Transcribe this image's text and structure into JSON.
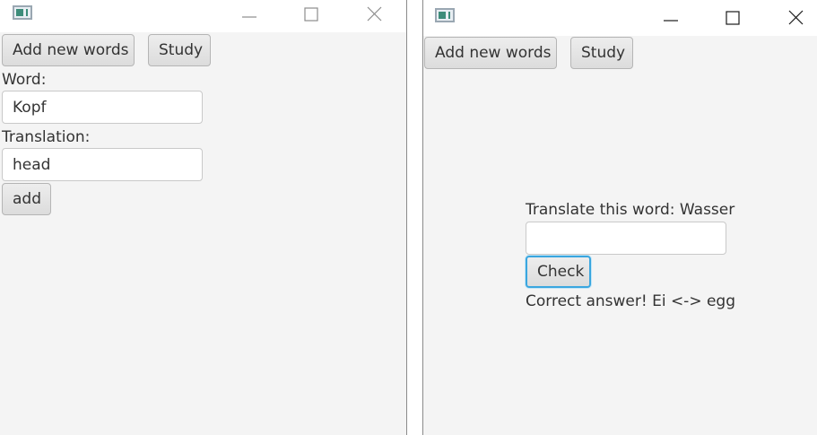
{
  "left_window": {
    "toolbar": {
      "add_new_words": "Add new words",
      "study": "Study"
    },
    "form": {
      "word_label": "Word:",
      "word_value": "Kopf",
      "translation_label": "Translation:",
      "translation_value": "head",
      "add_button": "add"
    }
  },
  "right_window": {
    "toolbar": {
      "add_new_words": "Add new words",
      "study": "Study"
    },
    "study": {
      "prompt": "Translate this word: Wasser",
      "answer_value": "",
      "check_button": "Check",
      "result": "Correct answer! Ei <-> egg"
    }
  },
  "icons": {
    "app": "app-window-icon",
    "minimize": "minimize-icon",
    "maximize": "maximize-icon",
    "close": "close-icon"
  },
  "colors": {
    "window_bg": "#f4f4f4",
    "titlebar_bg": "#ffffff",
    "focus_ring": "#3aa6df",
    "button_bg": "#e3e3e3",
    "text": "#333333"
  }
}
